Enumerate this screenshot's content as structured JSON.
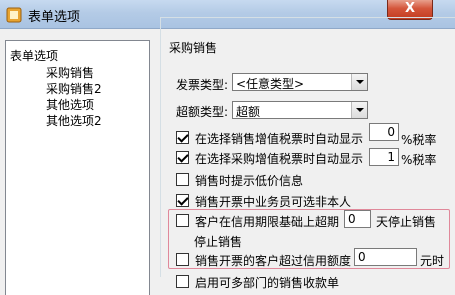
{
  "window": {
    "title": "表单选项",
    "close": "X"
  },
  "tree": {
    "items": [
      "表单选项",
      "采购销售",
      "采购销售2",
      "其他选项",
      "其他选项2"
    ]
  },
  "group": {
    "title": "采购销售"
  },
  "invoice_type": {
    "label": "发票类型:",
    "value": "<任意类型>"
  },
  "overdue_type": {
    "label": "超额类型:",
    "value": "超额"
  },
  "options": {
    "sales_vat": {
      "label": "在选择销售增值税票时自动显示",
      "value": "0",
      "suffix": "%税率",
      "checked": true
    },
    "purchase_vat": {
      "label": "在选择采购增值税票时自动显示",
      "value": "1",
      "suffix": "%税率",
      "checked": true
    },
    "low_price": {
      "label": "销售时提示低价信息",
      "checked": false
    },
    "non_self": {
      "label": "销售开票中业务员可选非本人",
      "checked": true
    },
    "credit_period": {
      "label": "客户在信用期限基础上超期",
      "value": "0",
      "suffix": "天停止销售",
      "wrap": "停止销售",
      "checked": false
    },
    "credit_limit": {
      "label": "销售开票的客户超过信用额度",
      "value": "0",
      "suffix": "元时",
      "checked": false
    },
    "multi_dept": {
      "label": "启用可多部门的销售收款单",
      "checked": false
    }
  }
}
